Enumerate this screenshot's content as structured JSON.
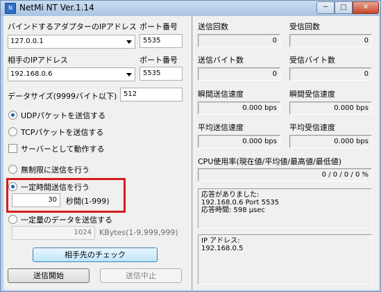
{
  "window": {
    "title": "NetMi NT Ver.1.14",
    "minimize_glyph": "─",
    "maximize_glyph": "□",
    "close_glyph": "✕"
  },
  "left": {
    "bind_adapter_label": "バインドするアダプターのIPアドレス",
    "bind_port_label": "ポート番号",
    "bind_ip_value": "127.0.0.1",
    "bind_port_value": "5535",
    "remote_ip_label": "相手のIPアドレス",
    "remote_port_label": "ポート番号",
    "remote_ip_value": "192.168.0.6",
    "remote_port_value": "5535",
    "data_size_label": "データサイズ(9999バイト以下)",
    "data_size_value": "512",
    "udp_label": "UDPパケットを送信する",
    "tcp_label": "TCPパケットを送信する",
    "server_label": "サーバーとして動作する",
    "unlimited_label": "無制限に送信を行う",
    "timed_label": "一定時間送信を行う",
    "timed_value": "30",
    "timed_unit": "秒間(1-999)",
    "amount_label": "一定量のデータを送信する",
    "amount_value": "1024",
    "amount_unit": "KBytes(1-9,999,999)",
    "check_button": "相手先のチェック",
    "start_button": "送信開始",
    "stop_button": "送信中止"
  },
  "right": {
    "send_count_label": "送信回数",
    "recv_count_label": "受信回数",
    "send_count_value": "0",
    "recv_count_value": "0",
    "send_bytes_label": "送信バイト数",
    "recv_bytes_label": "受信バイト数",
    "send_bytes_value": "0",
    "recv_bytes_value": "0",
    "inst_send_label": "瞬間送信速度",
    "inst_recv_label": "瞬間受信速度",
    "inst_send_value": "0.000 bps",
    "inst_recv_value": "0.000 bps",
    "avg_send_label": "平均送信速度",
    "avg_recv_label": "平均受信速度",
    "avg_send_value": "0.000 bps",
    "avg_recv_value": "0.000 bps",
    "cpu_label": "CPU使用率(現在値/平均値/最高値/最低値)",
    "cpu_value": "0 / 0 / 0 / 0 %",
    "response_text": "応答がありました:\n192.168.0.6 Port 5535\n応答時間: 598 μsec",
    "ip_text": "IP アドレス:\n192.168.0.5"
  }
}
